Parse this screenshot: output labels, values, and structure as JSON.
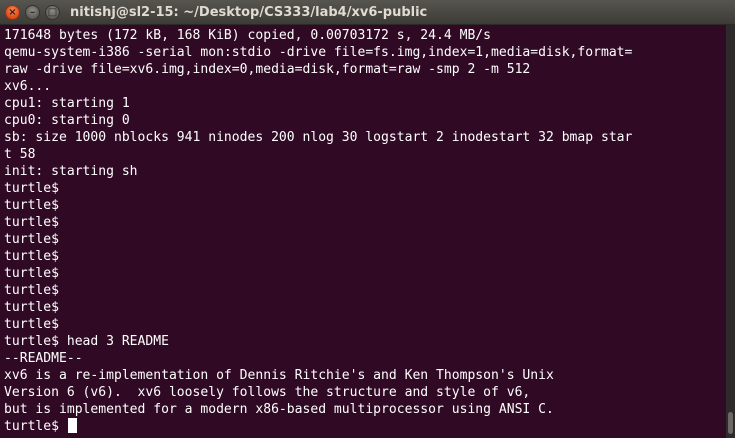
{
  "window": {
    "title": "nitishj@sl2-15: ~/Desktop/CS333/lab4/xv6-public",
    "close_glyph": "×",
    "minimize_glyph": "–",
    "maximize_glyph": "□"
  },
  "terminal": {
    "lines": [
      "171648 bytes (172 kB, 168 KiB) copied, 0.00703172 s, 24.4 MB/s",
      "qemu-system-i386 -serial mon:stdio -drive file=fs.img,index=1,media=disk,format=",
      "raw -drive file=xv6.img,index=0,media=disk,format=raw -smp 2 -m 512",
      "xv6...",
      "cpu1: starting 1",
      "cpu0: starting 0",
      "sb: size 1000 nblocks 941 ninodes 200 nlog 30 logstart 2 inodestart 32 bmap star",
      "t 58",
      "init: starting sh",
      "turtle$",
      "turtle$",
      "turtle$",
      "turtle$",
      "turtle$",
      "turtle$",
      "turtle$",
      "turtle$",
      "turtle$",
      "turtle$ head 3 README",
      "--README--",
      "xv6 is a re-implementation of Dennis Ritchie's and Ken Thompson's Unix",
      "Version 6 (v6).  xv6 loosely follows the structure and style of v6,",
      "but is implemented for a modern x86-based multiprocessor using ANSI C."
    ],
    "current_prompt": "turtle$ "
  },
  "colors": {
    "background": "#300a24",
    "text": "#ffffff",
    "titlebar": "#3c3b37",
    "close_button": "#df4a16"
  }
}
